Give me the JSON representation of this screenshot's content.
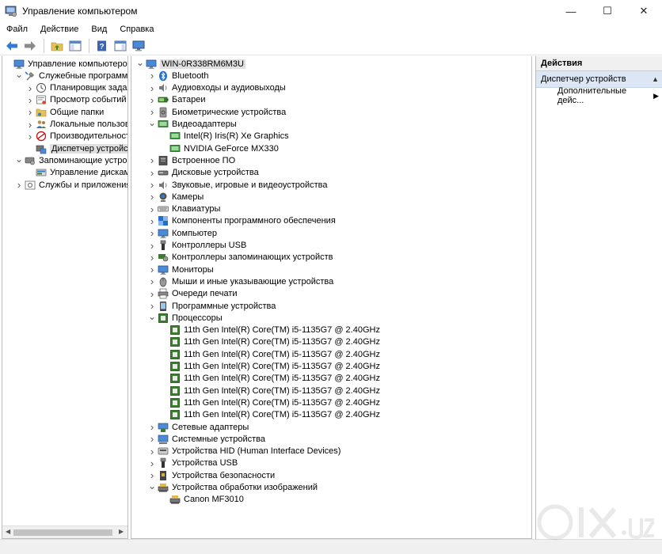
{
  "window": {
    "title": "Управление компьютером",
    "controls": {
      "minimize": "—",
      "maximize": "☐",
      "close": "✕"
    }
  },
  "menu": [
    "Файл",
    "Действие",
    "Вид",
    "Справка"
  ],
  "left_tree": [
    {
      "label": "Управление компьютером (лс",
      "level": 0,
      "expander": "",
      "icon": "computer-management-icon"
    },
    {
      "label": "Служебные программы",
      "level": 1,
      "expander": "v",
      "icon": "tools-icon"
    },
    {
      "label": "Планировщик заданий",
      "level": 2,
      "expander": ">",
      "icon": "clock-icon"
    },
    {
      "label": "Просмотр событий",
      "level": 2,
      "expander": ">",
      "icon": "event-viewer-icon"
    },
    {
      "label": "Общие папки",
      "level": 2,
      "expander": ">",
      "icon": "shared-folder-icon"
    },
    {
      "label": "Локальные пользовате",
      "level": 2,
      "expander": ">",
      "icon": "users-icon"
    },
    {
      "label": "Производительность",
      "level": 2,
      "expander": ">",
      "icon": "performance-icon"
    },
    {
      "label": "Диспетчер устройств",
      "level": 2,
      "expander": "",
      "icon": "device-manager-icon",
      "selected": true
    },
    {
      "label": "Запоминающие устройства",
      "level": 1,
      "expander": "v",
      "icon": "storage-icon"
    },
    {
      "label": "Управление дисками",
      "level": 2,
      "expander": "",
      "icon": "disk-management-icon"
    },
    {
      "label": "Службы и приложения",
      "level": 1,
      "expander": ">",
      "icon": "services-icon"
    }
  ],
  "device_tree": [
    {
      "label": "WIN-0R338RM6M3U",
      "level": 0,
      "expander": "v",
      "icon": "computer-icon",
      "selected": true
    },
    {
      "label": "Bluetooth",
      "level": 1,
      "expander": ">",
      "icon": "bluetooth-icon"
    },
    {
      "label": "Аудиовходы и аудиовыходы",
      "level": 1,
      "expander": ">",
      "icon": "speaker-icon"
    },
    {
      "label": "Батареи",
      "level": 1,
      "expander": ">",
      "icon": "battery-icon"
    },
    {
      "label": "Биометрические устройства",
      "level": 1,
      "expander": ">",
      "icon": "biometric-icon"
    },
    {
      "label": "Видеоадаптеры",
      "level": 1,
      "expander": "v",
      "icon": "display-adapter-icon"
    },
    {
      "label": "Intel(R) Iris(R) Xe Graphics",
      "level": 2,
      "expander": "",
      "icon": "display-adapter-icon"
    },
    {
      "label": "NVIDIA GeForce MX330",
      "level": 2,
      "expander": "",
      "icon": "display-adapter-icon"
    },
    {
      "label": "Встроенное ПО",
      "level": 1,
      "expander": ">",
      "icon": "firmware-icon"
    },
    {
      "label": "Дисковые устройства",
      "level": 1,
      "expander": ">",
      "icon": "disk-drive-icon"
    },
    {
      "label": "Звуковые, игровые и видеоустройства",
      "level": 1,
      "expander": ">",
      "icon": "sound-icon"
    },
    {
      "label": "Камеры",
      "level": 1,
      "expander": ">",
      "icon": "camera-icon"
    },
    {
      "label": "Клавиатуры",
      "level": 1,
      "expander": ">",
      "icon": "keyboard-icon"
    },
    {
      "label": "Компоненты программного обеспечения",
      "level": 1,
      "expander": ">",
      "icon": "software-component-icon"
    },
    {
      "label": "Компьютер",
      "level": 1,
      "expander": ">",
      "icon": "monitor-icon"
    },
    {
      "label": "Контроллеры USB",
      "level": 1,
      "expander": ">",
      "icon": "usb-icon"
    },
    {
      "label": "Контроллеры запоминающих устройств",
      "level": 1,
      "expander": ">",
      "icon": "storage-controller-icon"
    },
    {
      "label": "Мониторы",
      "level": 1,
      "expander": ">",
      "icon": "monitor-icon"
    },
    {
      "label": "Мыши и иные указывающие устройства",
      "level": 1,
      "expander": ">",
      "icon": "mouse-icon"
    },
    {
      "label": "Очереди печати",
      "level": 1,
      "expander": ">",
      "icon": "printer-icon"
    },
    {
      "label": "Программные устройства",
      "level": 1,
      "expander": ">",
      "icon": "software-device-icon"
    },
    {
      "label": "Процессоры",
      "level": 1,
      "expander": "v",
      "icon": "cpu-icon"
    },
    {
      "label": "11th Gen Intel(R) Core(TM) i5-1135G7 @ 2.40GHz",
      "level": 2,
      "expander": "",
      "icon": "cpu-icon"
    },
    {
      "label": "11th Gen Intel(R) Core(TM) i5-1135G7 @ 2.40GHz",
      "level": 2,
      "expander": "",
      "icon": "cpu-icon"
    },
    {
      "label": "11th Gen Intel(R) Core(TM) i5-1135G7 @ 2.40GHz",
      "level": 2,
      "expander": "",
      "icon": "cpu-icon"
    },
    {
      "label": "11th Gen Intel(R) Core(TM) i5-1135G7 @ 2.40GHz",
      "level": 2,
      "expander": "",
      "icon": "cpu-icon"
    },
    {
      "label": "11th Gen Intel(R) Core(TM) i5-1135G7 @ 2.40GHz",
      "level": 2,
      "expander": "",
      "icon": "cpu-icon"
    },
    {
      "label": "11th Gen Intel(R) Core(TM) i5-1135G7 @ 2.40GHz",
      "level": 2,
      "expander": "",
      "icon": "cpu-icon"
    },
    {
      "label": "11th Gen Intel(R) Core(TM) i5-1135G7 @ 2.40GHz",
      "level": 2,
      "expander": "",
      "icon": "cpu-icon"
    },
    {
      "label": "11th Gen Intel(R) Core(TM) i5-1135G7 @ 2.40GHz",
      "level": 2,
      "expander": "",
      "icon": "cpu-icon"
    },
    {
      "label": "Сетевые адаптеры",
      "level": 1,
      "expander": ">",
      "icon": "network-adapter-icon"
    },
    {
      "label": "Системные устройства",
      "level": 1,
      "expander": ">",
      "icon": "system-device-icon"
    },
    {
      "label": "Устройства HID (Human Interface Devices)",
      "level": 1,
      "expander": ">",
      "icon": "hid-icon"
    },
    {
      "label": "Устройства USB",
      "level": 1,
      "expander": ">",
      "icon": "usb-icon"
    },
    {
      "label": "Устройства безопасности",
      "level": 1,
      "expander": ">",
      "icon": "security-device-icon"
    },
    {
      "label": "Устройства обработки изображений",
      "level": 1,
      "expander": "v",
      "icon": "imaging-icon"
    },
    {
      "label": "Canon MF3010",
      "level": 2,
      "expander": "",
      "icon": "scanner-icon"
    }
  ],
  "actions": {
    "header": "Действия",
    "section": "Диспетчер устройств",
    "item": "Дополнительные дейс..."
  },
  "colors": {
    "selection": "#e0e0e0",
    "action_section_bg": "#dce6f4",
    "accent_blue": "#1f6fd1",
    "cpu_green": "#3a7d2c"
  }
}
